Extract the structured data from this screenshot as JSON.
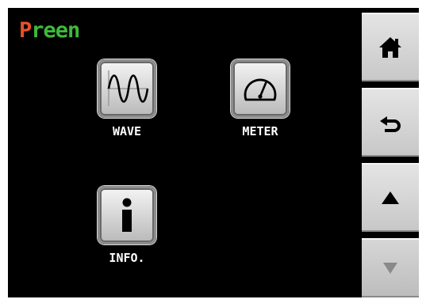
{
  "header": {
    "logo_first": "P",
    "logo_rest": "reen",
    "logo_colors": {
      "first": "#e8502a",
      "rest": "#3fb83c"
    }
  },
  "apps": [
    {
      "label": "WAVE",
      "icon": "sine-wave-icon"
    },
    {
      "label": "METER",
      "icon": "gauge-icon"
    },
    {
      "label": "INFO.",
      "icon": "info-icon"
    }
  ],
  "side_buttons": [
    {
      "icon": "home-icon",
      "enabled": true
    },
    {
      "icon": "back-arrow-icon",
      "enabled": true
    },
    {
      "icon": "up-triangle-icon",
      "enabled": true
    },
    {
      "icon": "down-triangle-icon",
      "enabled": false
    }
  ],
  "colors": {
    "screen_bg": "#000000",
    "button_face": "#d8d8d8",
    "icon_active": "#000000",
    "icon_disabled": "#8a8a8a"
  }
}
